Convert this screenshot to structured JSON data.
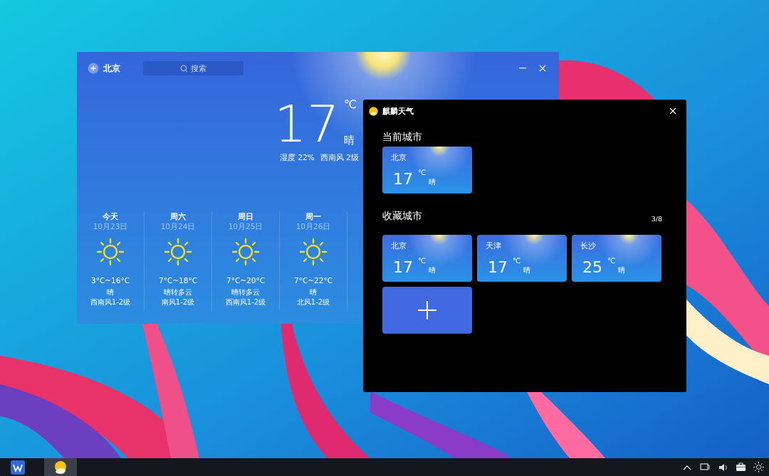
{
  "main_window": {
    "city": "北京",
    "search": {
      "placeholder": "搜索"
    },
    "current": {
      "temperature": "17",
      "unit": "℃",
      "condition": "晴",
      "humidity": "湿度 22%",
      "wind": "西南风 2级"
    },
    "forecast": [
      {
        "day": "今天",
        "date": "10月23日",
        "range": "3°C~16°C",
        "condition": "晴",
        "wind": "西南风1-2级"
      },
      {
        "day": "周六",
        "date": "10月24日",
        "range": "7°C~18°C",
        "condition": "晴转多云",
        "wind": "南风1-2级"
      },
      {
        "day": "周日",
        "date": "10月25日",
        "range": "7°C~20°C",
        "condition": "晴转多云",
        "wind": "西南风1-2级"
      },
      {
        "day": "周一",
        "date": "10月26日",
        "range": "7°C~22°C",
        "condition": "晴",
        "wind": "北风1-2级"
      }
    ]
  },
  "city_window": {
    "title": "麒麟天气",
    "current_heading": "当前城市",
    "current_city": {
      "city": "北京",
      "temperature": "17",
      "unit": "℃",
      "condition": "晴"
    },
    "favorites_heading": "收藏城市",
    "favorites_count": "3/8",
    "favorites": [
      {
        "city": "北京",
        "temperature": "17",
        "unit": "℃",
        "condition": "晴"
      },
      {
        "city": "天津",
        "temperature": "17",
        "unit": "℃",
        "condition": "晴"
      },
      {
        "city": "长沙",
        "temperature": "25",
        "unit": "℃",
        "condition": "晴"
      }
    ]
  },
  "taskbar": {
    "apps": [
      {
        "kind": "start",
        "selected": false
      },
      {
        "kind": "weather",
        "selected": true
      }
    ],
    "tray": [
      {
        "kind": "chevron"
      },
      {
        "kind": "display"
      },
      {
        "kind": "volume"
      },
      {
        "kind": "briefcase"
      },
      {
        "kind": "brightness"
      }
    ]
  }
}
